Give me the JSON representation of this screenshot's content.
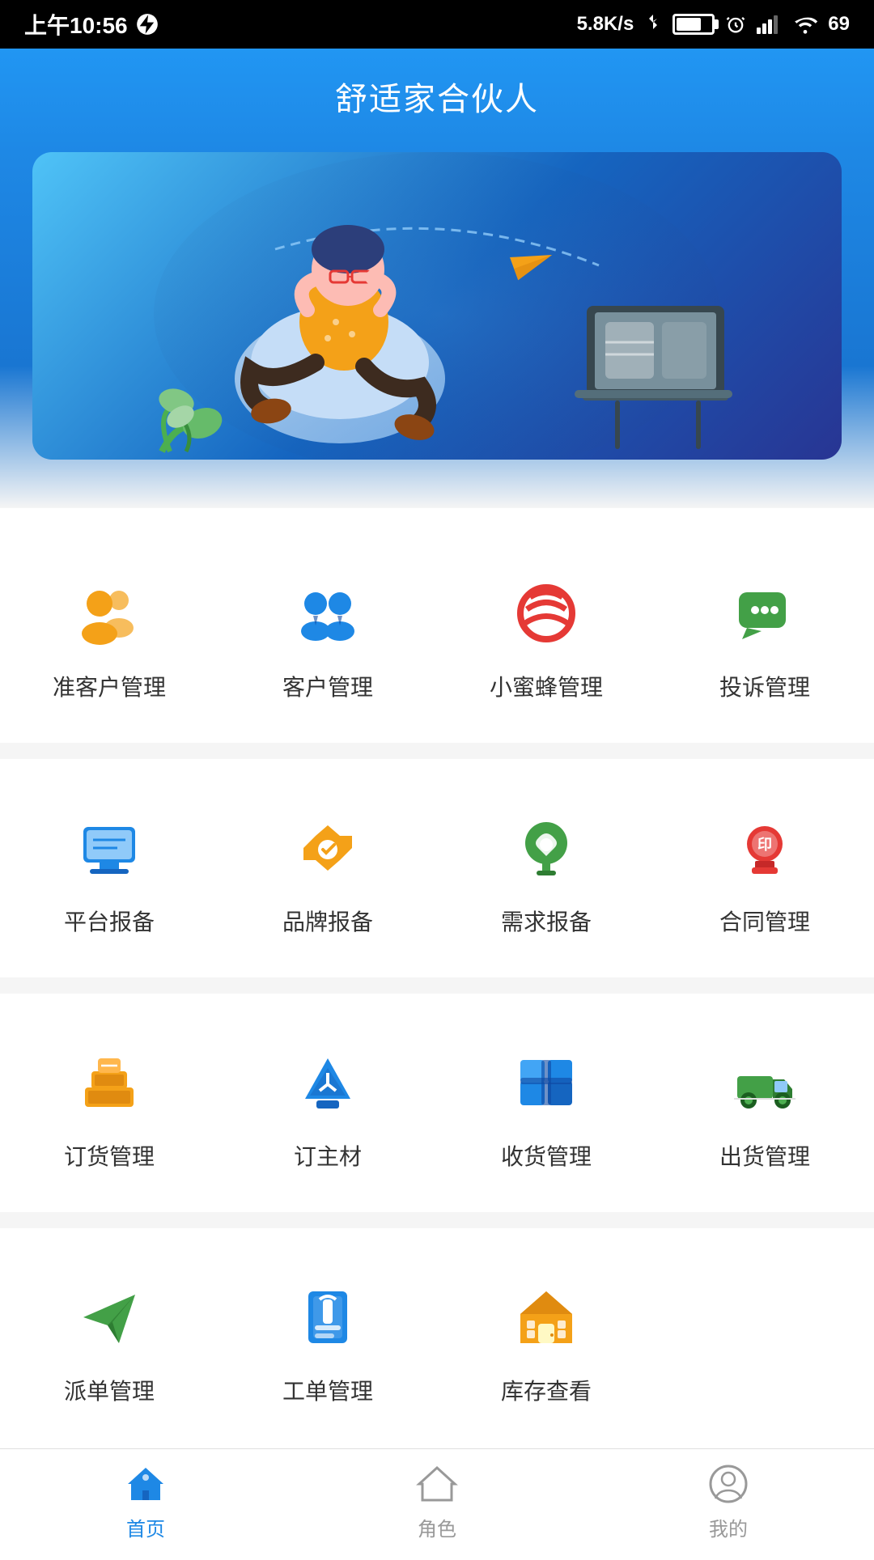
{
  "statusBar": {
    "time": "上午10:56",
    "network": "5.8K/s",
    "battery": "69"
  },
  "header": {
    "title": "舒适家合伙人"
  },
  "menuSections": [
    {
      "id": "section1",
      "items": [
        {
          "id": "prospect",
          "label": "准客户管理",
          "iconColor": "#F4A118",
          "iconType": "user-group"
        },
        {
          "id": "customer",
          "label": "客户管理",
          "iconColor": "#1E88E5",
          "iconType": "customers"
        },
        {
          "id": "bee",
          "label": "小蜜蜂管理",
          "iconColor": "#E53935",
          "iconType": "bee"
        },
        {
          "id": "complaint",
          "label": "投诉管理",
          "iconColor": "#43A047",
          "iconType": "chat"
        }
      ]
    },
    {
      "id": "section2",
      "items": [
        {
          "id": "platform",
          "label": "平台报备",
          "iconColor": "#1E88E5",
          "iconType": "monitor"
        },
        {
          "id": "brand",
          "label": "品牌报备",
          "iconColor": "#F4A118",
          "iconType": "heart-tag"
        },
        {
          "id": "demand",
          "label": "需求报备",
          "iconColor": "#43A047",
          "iconType": "lightbulb"
        },
        {
          "id": "contract",
          "label": "合同管理",
          "iconColor": "#E53935",
          "iconType": "stamp"
        }
      ]
    },
    {
      "id": "section3",
      "items": [
        {
          "id": "order",
          "label": "订货管理",
          "iconColor": "#F4A118",
          "iconType": "boxes"
        },
        {
          "id": "material",
          "label": "订主材",
          "iconColor": "#1E88E5",
          "iconType": "triangle-stack"
        },
        {
          "id": "receive",
          "label": "收货管理",
          "iconColor": "#1E88E5",
          "iconType": "package"
        },
        {
          "id": "ship",
          "label": "出货管理",
          "iconColor": "#43A047",
          "iconType": "truck"
        }
      ]
    },
    {
      "id": "section4",
      "items": [
        {
          "id": "dispatch",
          "label": "派单管理",
          "iconColor": "#43A047",
          "iconType": "send"
        },
        {
          "id": "workorder",
          "label": "工单管理",
          "iconColor": "#1E88E5",
          "iconType": "clipboard"
        },
        {
          "id": "inventory",
          "label": "库存查看",
          "iconColor": "#F4A118",
          "iconType": "house-grid"
        }
      ]
    }
  ],
  "tabBar": {
    "tabs": [
      {
        "id": "home",
        "label": "首页",
        "active": true
      },
      {
        "id": "role",
        "label": "角色",
        "active": false
      },
      {
        "id": "mine",
        "label": "我的",
        "active": false
      }
    ]
  }
}
